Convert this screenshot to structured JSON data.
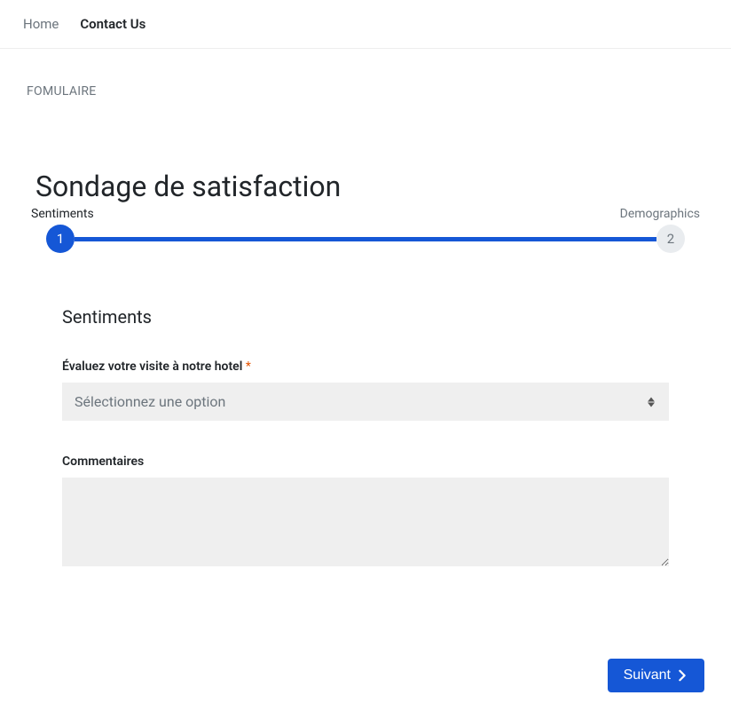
{
  "nav": {
    "home": "Home",
    "contact": "Contact Us"
  },
  "breadcrumb": "FOMULAIRE",
  "page_title": "Sondage de satisfaction",
  "progress": {
    "step1_label": "Sentiments",
    "step2_label": "Demographics",
    "step1_number": "1",
    "step2_number": "2"
  },
  "form": {
    "section_heading": "Sentiments",
    "rating_label": "Évaluez votre visite à notre hotel",
    "rating_placeholder": "Sélectionnez une option",
    "comments_label": "Commentaires"
  },
  "buttons": {
    "next": "Suivant"
  }
}
